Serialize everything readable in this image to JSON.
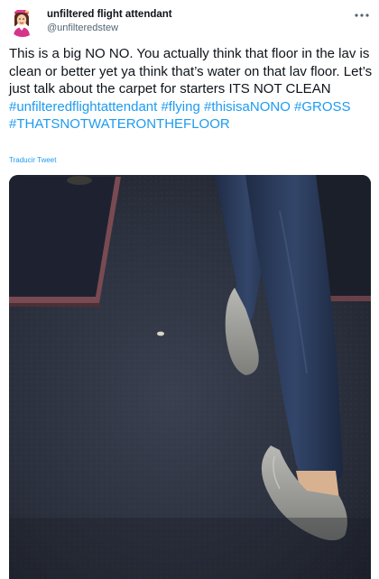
{
  "author": {
    "display_name": "unfiltered flight attendant",
    "handle": "@unfilteredstew",
    "avatar_icon": "flight-attendant-avatar-icon"
  },
  "more_icon": "more-options-icon",
  "tweet": {
    "text_parts": [
      "This is a big NO NO.   You actually think that floor in the lav is clean or better yet ya think that’s water on that lav floor. Let’s just talk about the carpet for starters ITS NOT CLEAN "
    ],
    "hashtags": [
      "#unfilteredflightattendant",
      "#flying",
      "#thisisaNONO",
      "#GROSS",
      "#THATSNOTWATERONTHEFLOOR"
    ]
  },
  "translate_label": "Traducir Tweet",
  "colors": {
    "link": "#1d9bf0",
    "text": "#0f1419",
    "secondary": "#536471"
  },
  "media": {
    "type": "photo",
    "subject": "aircraft-lavatory-floor-photo"
  }
}
